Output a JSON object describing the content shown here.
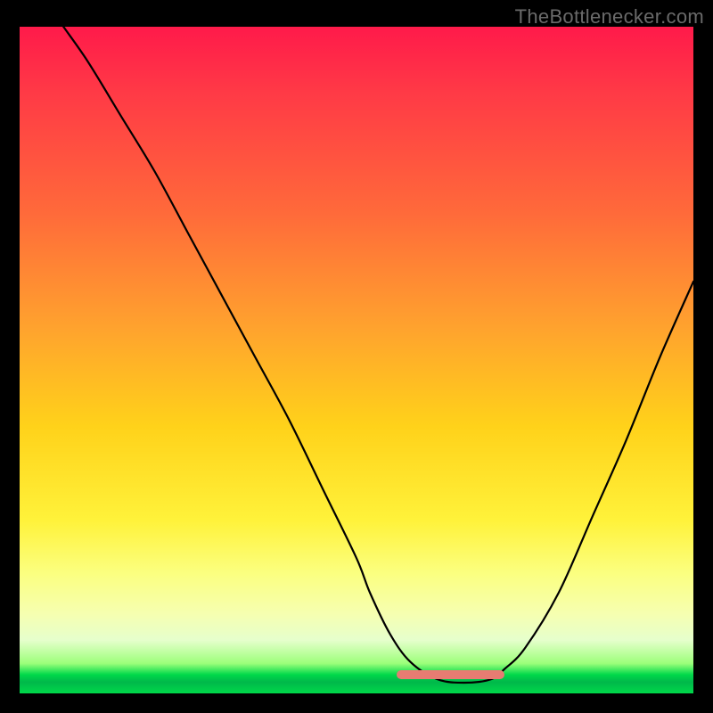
{
  "watermark": "TheBottlenecker.com",
  "colors": {
    "curve": "#000000",
    "marker": "#e77c72",
    "frame_bg": "#000000"
  },
  "chart_data": {
    "type": "line",
    "title": "",
    "xlabel": "",
    "ylabel": "",
    "xlim": [
      0,
      100
    ],
    "ylim": [
      0,
      100
    ],
    "x": [
      0,
      5,
      10,
      15,
      20,
      25,
      30,
      35,
      40,
      45,
      50,
      52,
      55,
      58,
      62,
      66,
      70,
      72,
      75,
      80,
      85,
      90,
      95,
      100
    ],
    "values": [
      105,
      97,
      90,
      82,
      74,
      65,
      56,
      47,
      38,
      28,
      18,
      13,
      7,
      3,
      0.5,
      0,
      0.5,
      2,
      5,
      13,
      24,
      35,
      47,
      58
    ],
    "optimal_range_x": [
      56,
      72
    ],
    "optimal_y": 1.2,
    "note": "Values approximate bottleneck percentage curve; x is normalized hardware balance axis, y is bottleneck magnitude. Optimal (near-zero bottleneck) zone highlighted."
  }
}
